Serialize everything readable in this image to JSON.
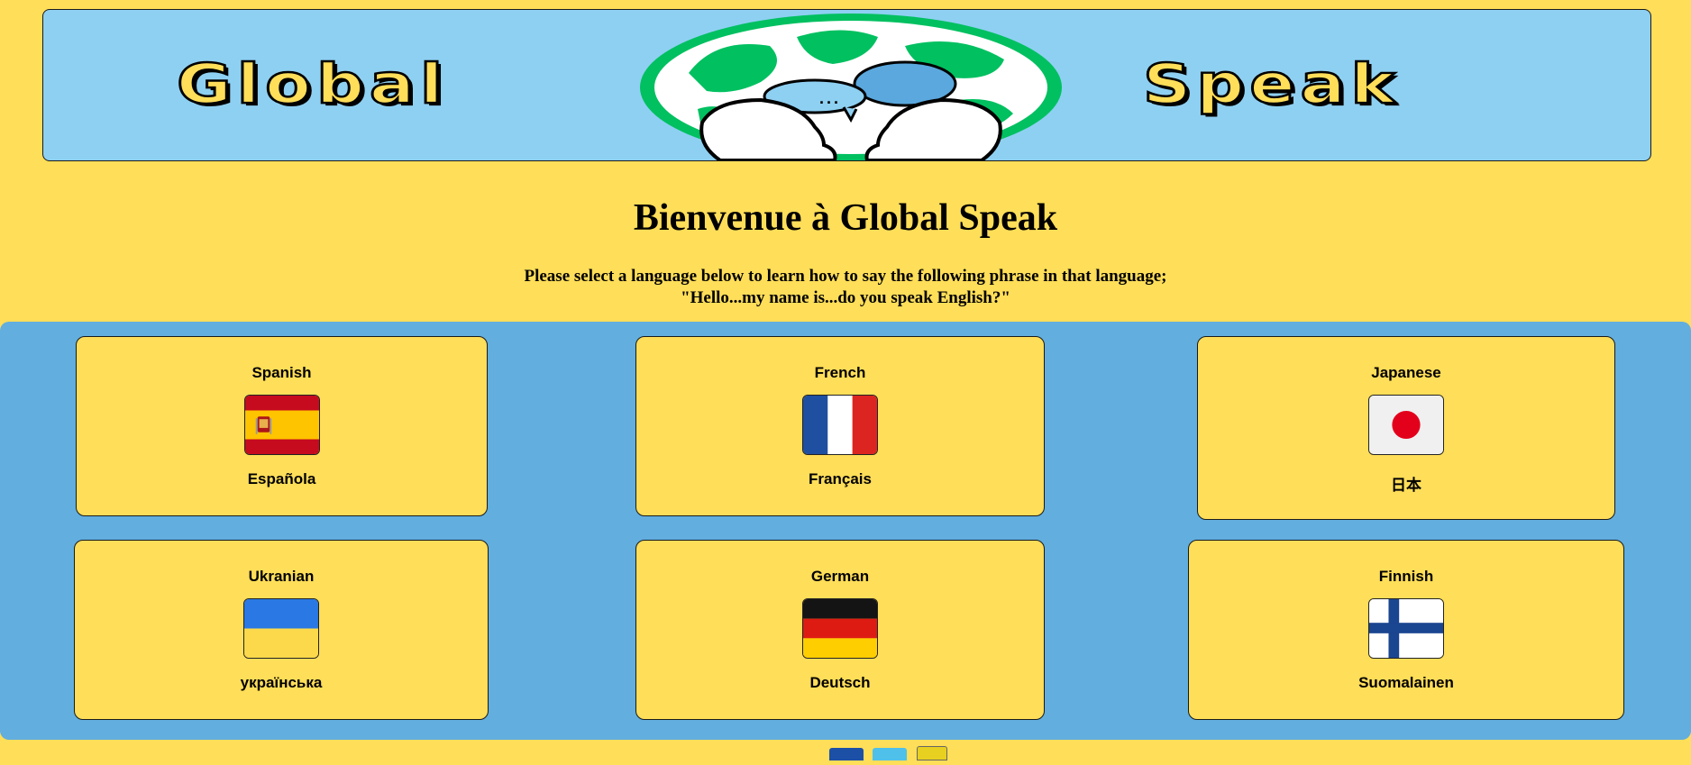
{
  "header": {
    "logo_left": "Global",
    "logo_right": "Speak",
    "speech_bubble": "..."
  },
  "main": {
    "title": "Bienvenue à Global Speak",
    "intro_line1": "Please select a language below to learn how to say the following phrase in that language;",
    "intro_line2": "\"Hello...my name is...do you speak English?\""
  },
  "languages": [
    {
      "name": "Spanish",
      "native": "Española",
      "flag": "spain-flag-icon"
    },
    {
      "name": "French",
      "native": "Français",
      "flag": "france-flag-icon"
    },
    {
      "name": "Japanese",
      "native": "日本",
      "flag": "japan-flag-icon"
    },
    {
      "name": "Ukranian",
      "native": "українська",
      "flag": "ukraine-flag-icon"
    },
    {
      "name": "German",
      "native": "Deutsch",
      "flag": "germany-flag-icon"
    },
    {
      "name": "Finnish",
      "native": "Suomalainen",
      "flag": "finland-flag-icon"
    }
  ],
  "footer": {
    "icons": [
      "facebook-icon",
      "twitter-icon",
      "badge-icon"
    ]
  },
  "colors": {
    "page_bg": "#ffde59",
    "banner_bg": "#8ed0f2",
    "grid_bg": "#62aede",
    "card_bg": "#ffde59",
    "globe_green": "#00c060"
  }
}
